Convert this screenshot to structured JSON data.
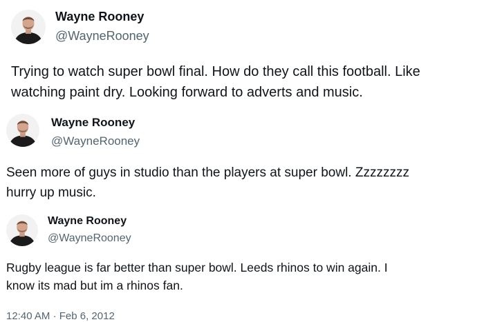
{
  "tweets": [
    {
      "display_name": "Wayne Rooney",
      "handle": "@WayneRooney",
      "text_lines": [
        "Trying to watch super bowl final. How do they call this football. Like",
        "watching paint dry. Looking forward to adverts and music."
      ]
    },
    {
      "display_name": "Wayne Rooney",
      "handle": "@WayneRooney",
      "text_lines": [
        "Seen more of guys in studio than the players at super bowl. Zzzzzzzz",
        "hurry up music."
      ]
    },
    {
      "display_name": "Wayne Rooney",
      "handle": "@WayneRooney",
      "text_lines": [
        "Rugby league is far better than super bowl. Leeds rhinos to win again. I",
        "know its mad but im a rhinos fan."
      ]
    }
  ],
  "meta": {
    "time": "12:40 AM",
    "separator": "·",
    "date": "Feb 6, 2012"
  },
  "colors": {
    "text": "#0f1419",
    "secondary": "#536471"
  },
  "icons": {
    "avatar": "profile-photo-avatar"
  }
}
